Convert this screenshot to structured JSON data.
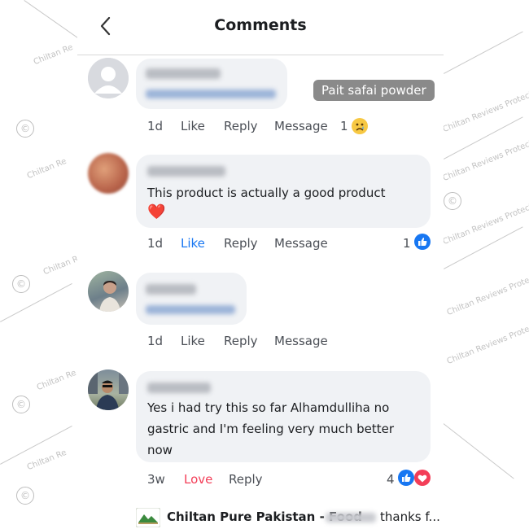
{
  "header": {
    "title": "Comments"
  },
  "tooltip": {
    "text": "Pait safai powder"
  },
  "comments": [
    {
      "text": "",
      "time": "1d",
      "like": "Like",
      "reply": "Reply",
      "message": "Message",
      "reaction_count": "1",
      "reaction_icon": "sad-reaction-icon"
    },
    {
      "text": "This product is actually a good product",
      "emoji": "❤️",
      "time": "1d",
      "like": "Like",
      "reply": "Reply",
      "message": "Message",
      "reaction_count": "1",
      "reaction_icon": "like-reaction-icon"
    },
    {
      "text": "",
      "time": "1d",
      "like": "Like",
      "reply": "Reply",
      "message": "Message"
    },
    {
      "text_lines": [
        "Yes i had try this so far Alhamdulliha no",
        "gastric and I'm feeling very much better",
        "now"
      ],
      "time": "3w",
      "love": "Love",
      "reply": "Reply",
      "reaction_count": "4",
      "reaction_icons": [
        "like-reaction-icon",
        "love-reaction-icon"
      ]
    }
  ],
  "footer": {
    "page_name": "Chiltan Pure Pakistan - Food",
    "tail": "thanks f..."
  },
  "watermark": {
    "brand": "Chiltan Reviews Protected",
    "copyright": "©",
    "short": "Chiltan Re"
  },
  "colors": {
    "like_blue": "#1877f2",
    "love_red": "#f33e58",
    "bubble_bg": "#f0f2f5",
    "tooltip_bg": "#8a8a8a"
  }
}
